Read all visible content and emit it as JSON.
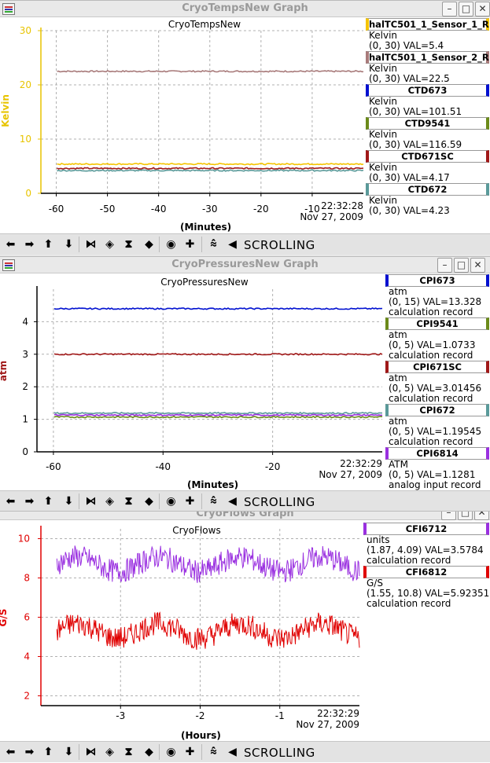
{
  "windows": [
    {
      "title": "CryoTempsNew Graph",
      "plot_title": "CryoTempsNew",
      "ylabel": "Kelvin",
      "ylabel_color": "#e8c400",
      "axis_color": "#e8c400",
      "xlabel": "(Minutes)",
      "timestamp_time": "22:32:28",
      "timestamp_date": "Nov 27, 2009",
      "legend": [
        {
          "name": "halTC501_1_Sensor_1_R",
          "color": "#f5c400",
          "unit": "Kelvin",
          "info": "(0, 30) VAL=5.4",
          "extra": ""
        },
        {
          "name": "halTC501_1_Sensor_2_R",
          "color": "#a87a7a",
          "unit": "Kelvin",
          "info": "(0, 30) VAL=22.5",
          "extra": ""
        },
        {
          "name": "CTD673",
          "color": "#0010d0",
          "unit": "Kelvin",
          "info": "(0, 30) VAL=101.51",
          "extra": ""
        },
        {
          "name": "CTD9541",
          "color": "#6b8a1a",
          "unit": "Kelvin",
          "info": "(0, 30) VAL=116.59",
          "extra": ""
        },
        {
          "name": "CTD671SC",
          "color": "#a01818",
          "unit": "Kelvin",
          "info": "(0, 30) VAL=4.17",
          "extra": ""
        },
        {
          "name": "CTD672",
          "color": "#5a9a9a",
          "unit": "Kelvin",
          "info": "(0, 30) VAL=4.23",
          "extra": ""
        }
      ]
    },
    {
      "title": "CryoPressuresNew Graph",
      "plot_title": "CryoPressuresNew",
      "ylabel": "atm",
      "ylabel_color": "#a01818",
      "axis_color": "#000000",
      "xlabel": "(Minutes)",
      "timestamp_time": "22:32:29",
      "timestamp_date": "Nov 27, 2009",
      "legend": [
        {
          "name": "CPI673",
          "color": "#0010d0",
          "unit": "atm",
          "info": "(0, 15) VAL=13.328",
          "extra": "calculation record"
        },
        {
          "name": "CPI9541",
          "color": "#6b8a1a",
          "unit": "atm",
          "info": "(0, 5) VAL=1.0733",
          "extra": "calculation record"
        },
        {
          "name": "CPI671SC",
          "color": "#a01818",
          "unit": "atm",
          "info": "(0, 5) VAL=3.01456",
          "extra": "calculation record"
        },
        {
          "name": "CPI672",
          "color": "#5a9a9a",
          "unit": "atm",
          "info": "(0, 5) VAL=1.19545",
          "extra": "calculation record"
        },
        {
          "name": "CPI6814",
          "color": "#9a30e0",
          "unit": "ATM",
          "info": "(0, 5) VAL=1.1281",
          "extra": "analog input record"
        }
      ]
    },
    {
      "title": "CryoFlows Graph",
      "plot_title": "CryoFlows",
      "ylabel": "G/S",
      "ylabel_color": "#e00000",
      "axis_color": "#e00000",
      "xlabel": "(Hours)",
      "timestamp_time": "22:32:29",
      "timestamp_date": "Nov 27, 2009",
      "legend": [
        {
          "name": "CFI6712",
          "color": "#9a30e0",
          "unit": "units",
          "info": "(1.87, 4.09) VAL=3.5784",
          "extra": "calculation record"
        },
        {
          "name": "CFI6812",
          "color": "#e00000",
          "unit": "G/S",
          "info": "(1.55, 10.8) VAL=5.92351",
          "extra": "calculation record"
        }
      ]
    }
  ],
  "toolbar": {
    "scrolling_label": "SCROLLING",
    "icons": [
      "arrow-left-icon",
      "arrow-right-icon",
      "arrow-up-icon",
      "arrow-down-icon",
      "zoom-in-x-icon",
      "zoom-out-x-icon",
      "zoom-in-y-icon",
      "zoom-out-y-icon",
      "reset-icon",
      "add-icon",
      "toggle-scroll-icon",
      "step-back-icon"
    ]
  },
  "chart_data": [
    {
      "type": "line",
      "title": "CryoTempsNew",
      "xlabel": "(Minutes)",
      "ylabel": "Kelvin",
      "xlim": [
        -63,
        0
      ],
      "ylim": [
        0,
        30
      ],
      "xticks": [
        -60,
        -50,
        -40,
        -30,
        -20,
        -10
      ],
      "yticks": [
        0,
        10,
        20,
        30
      ],
      "grid": true,
      "series": [
        {
          "name": "halTC501_1_Sensor_2_R",
          "color": "#a87a7a",
          "level": 22.5
        },
        {
          "name": "halTC501_1_Sensor_1_R",
          "color": "#f5c400",
          "level": 5.4
        },
        {
          "name": "CTD671SC",
          "color": "#a01818",
          "level": 4.6
        },
        {
          "name": "CTD672",
          "color": "#5a9a9a",
          "level": 4.2
        }
      ]
    },
    {
      "type": "line",
      "title": "CryoPressuresNew",
      "xlabel": "(Minutes)",
      "ylabel": "atm",
      "xlim": [
        -63,
        0
      ],
      "ylim": [
        0,
        5
      ],
      "xticks": [
        -60,
        -40,
        -20
      ],
      "yticks": [
        0,
        1,
        2,
        3,
        4
      ],
      "grid": true,
      "series": [
        {
          "name": "CPI673",
          "color": "#0010d0",
          "level": 4.4
        },
        {
          "name": "CPI671SC",
          "color": "#a01818",
          "level": 3.0
        },
        {
          "name": "CPI672",
          "color": "#5a9a9a",
          "level": 1.19
        },
        {
          "name": "CPI6814",
          "color": "#9a30e0",
          "level": 1.13
        },
        {
          "name": "CPI9541",
          "color": "#6b8a1a",
          "level": 1.07
        }
      ]
    },
    {
      "type": "line",
      "title": "CryoFlows",
      "xlabel": "(Hours)",
      "ylabel": "G/S",
      "xlim": [
        -4,
        0
      ],
      "ylim": [
        1.5,
        10.5
      ],
      "xticks": [
        -3,
        -2,
        -1
      ],
      "yticks": [
        2,
        4,
        6,
        8,
        10
      ],
      "grid": true,
      "series": [
        {
          "name": "CFI6712",
          "color": "#9a30e0",
          "level": 8.7
        },
        {
          "name": "CFI6812",
          "color": "#e00000",
          "level": 5.3
        }
      ]
    }
  ]
}
